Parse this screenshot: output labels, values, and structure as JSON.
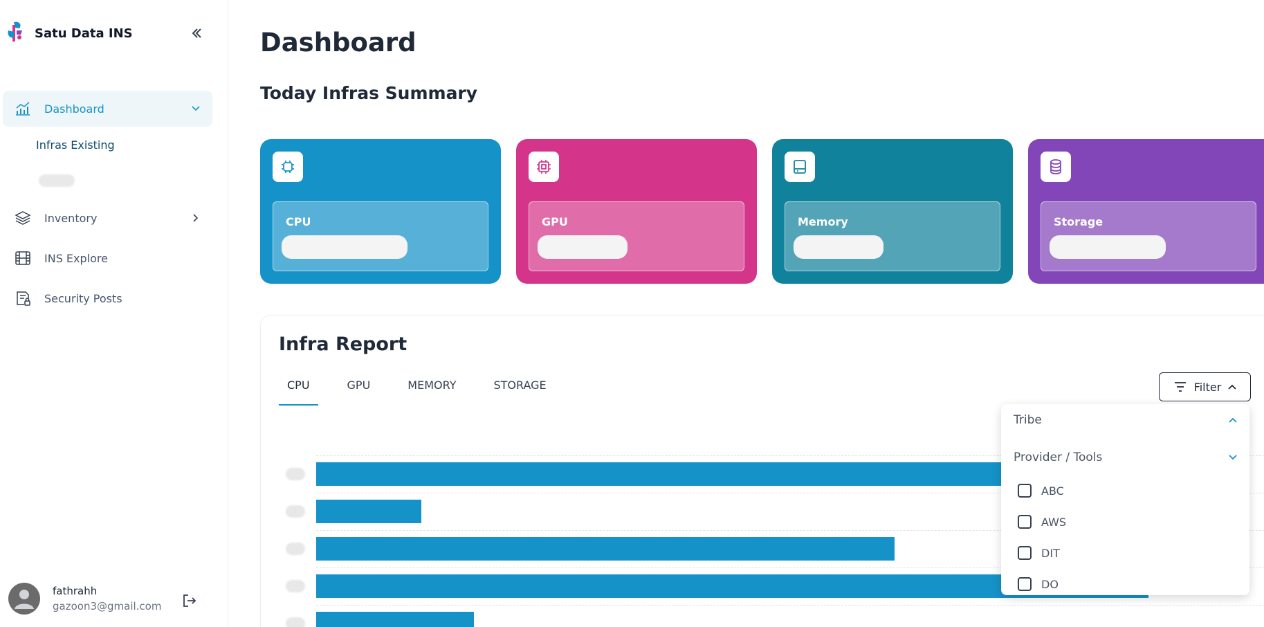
{
  "app": {
    "title": "Satu Data INS"
  },
  "sidebar": {
    "items": [
      {
        "label": "Dashboard",
        "icon": "chart-icon",
        "active": true
      },
      {
        "label": "Inventory",
        "icon": "layers-icon"
      },
      {
        "label": "INS Explore",
        "icon": "film-icon"
      },
      {
        "label": "Security Posts",
        "icon": "document-lock-icon"
      }
    ],
    "subitems": [
      {
        "label": "Infras Existing"
      }
    ]
  },
  "user": {
    "name": "fathrahh",
    "email": "gazoon3@gmail.com"
  },
  "page": {
    "title": "Dashboard",
    "summary_title": "Today Infras Summary"
  },
  "cards": [
    {
      "label": "CPU",
      "color": "#1592c8",
      "icon": "cpu-icon"
    },
    {
      "label": "GPU",
      "color": "#d4358a",
      "icon": "gpu-icon"
    },
    {
      "label": "Memory",
      "color": "#11829c",
      "icon": "memory-icon"
    },
    {
      "label": "Storage",
      "color": "#8346b8",
      "icon": "database-icon"
    }
  ],
  "report": {
    "title": "Infra Report",
    "tabs": [
      {
        "label": "CPU",
        "active": true
      },
      {
        "label": "GPU"
      },
      {
        "label": "MEMORY"
      },
      {
        "label": "STORAGE"
      }
    ],
    "filter_label": "Filter"
  },
  "filter_dropdown": {
    "sections": [
      {
        "label": "Tribe",
        "expanded": false
      },
      {
        "label": "Provider / Tools",
        "expanded": true
      }
    ],
    "options": [
      {
        "label": "ABC",
        "checked": false
      },
      {
        "label": "AWS",
        "checked": false
      },
      {
        "label": "DIT",
        "checked": false
      },
      {
        "label": "DO",
        "checked": false
      }
    ]
  },
  "chart_data": {
    "type": "bar",
    "orientation": "horizontal",
    "bar_color": "#1592c8",
    "values": [
      100,
      12,
      66,
      95,
      18
    ]
  }
}
